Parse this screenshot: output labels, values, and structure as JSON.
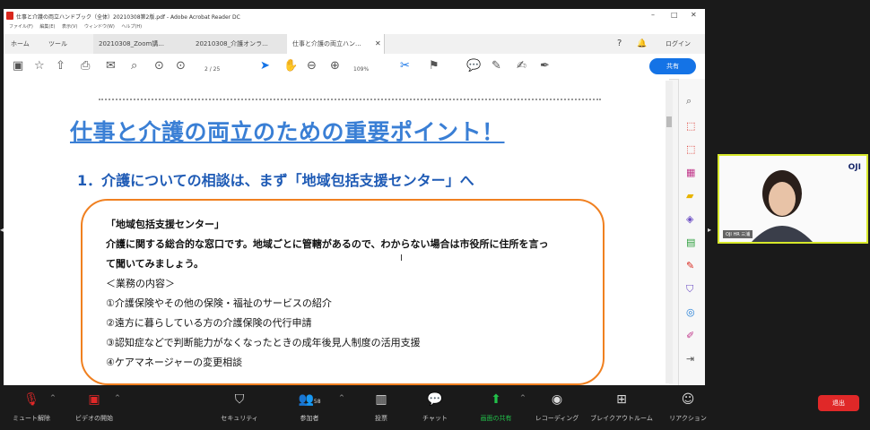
{
  "window": {
    "title": "仕事と介護の両立ハンドブック（全体）20210308第2版.pdf - Adobe Acrobat Reader DC",
    "menu": [
      "ファイル(F)",
      "編集(E)",
      "表示(V)",
      "ウィンドウ(W)",
      "ヘルプ(H)"
    ]
  },
  "tabs": {
    "home": "ホーム",
    "tools": "ツール",
    "doc1": "20210308_Zoom講...",
    "doc2": "20210308_介護オンラ...",
    "doc3": "仕事と介護の両立ハン..."
  },
  "account": {
    "login": "ログイン"
  },
  "toolbar": {
    "page_current": "2",
    "page_total": "/ 25",
    "zoom": "109%",
    "share": "共有"
  },
  "document": {
    "heading": "仕事と介護の両立のための重要ポイント！",
    "subheading": "1．介護についての相談は、まず「地域包括支援センター」へ",
    "box_lines": [
      "「地域包括支援センター」",
      "介護に関する総合的な窓口です。地域ごとに管轄があるので、わからない場合は市役所に住所を言っ",
      "て聞いてみましょう。",
      "＜業務の内容＞",
      "①介護保険やその他の保険・福祉のサービスの紹介",
      "②遠方に暮らしている方の介護保険の代行申請",
      "③認知症などで判断能力がなくなったときの成年後見人制度の活用支援",
      "④ケアマネージャーの変更相談"
    ]
  },
  "video": {
    "logo": "OJI",
    "name": "OJI HR 三浦"
  },
  "zoom_bar": {
    "mute": "ミュート解除",
    "video": "ビデオの開始",
    "security": "セキュリティ",
    "participants": "参加者",
    "participants_count": "58",
    "poll": "投票",
    "chat": "チャット",
    "share": "画面の共有",
    "record": "レコーディング",
    "breakout": "ブレイクアウトルーム",
    "reactions": "リアクション",
    "leave": "退出"
  }
}
